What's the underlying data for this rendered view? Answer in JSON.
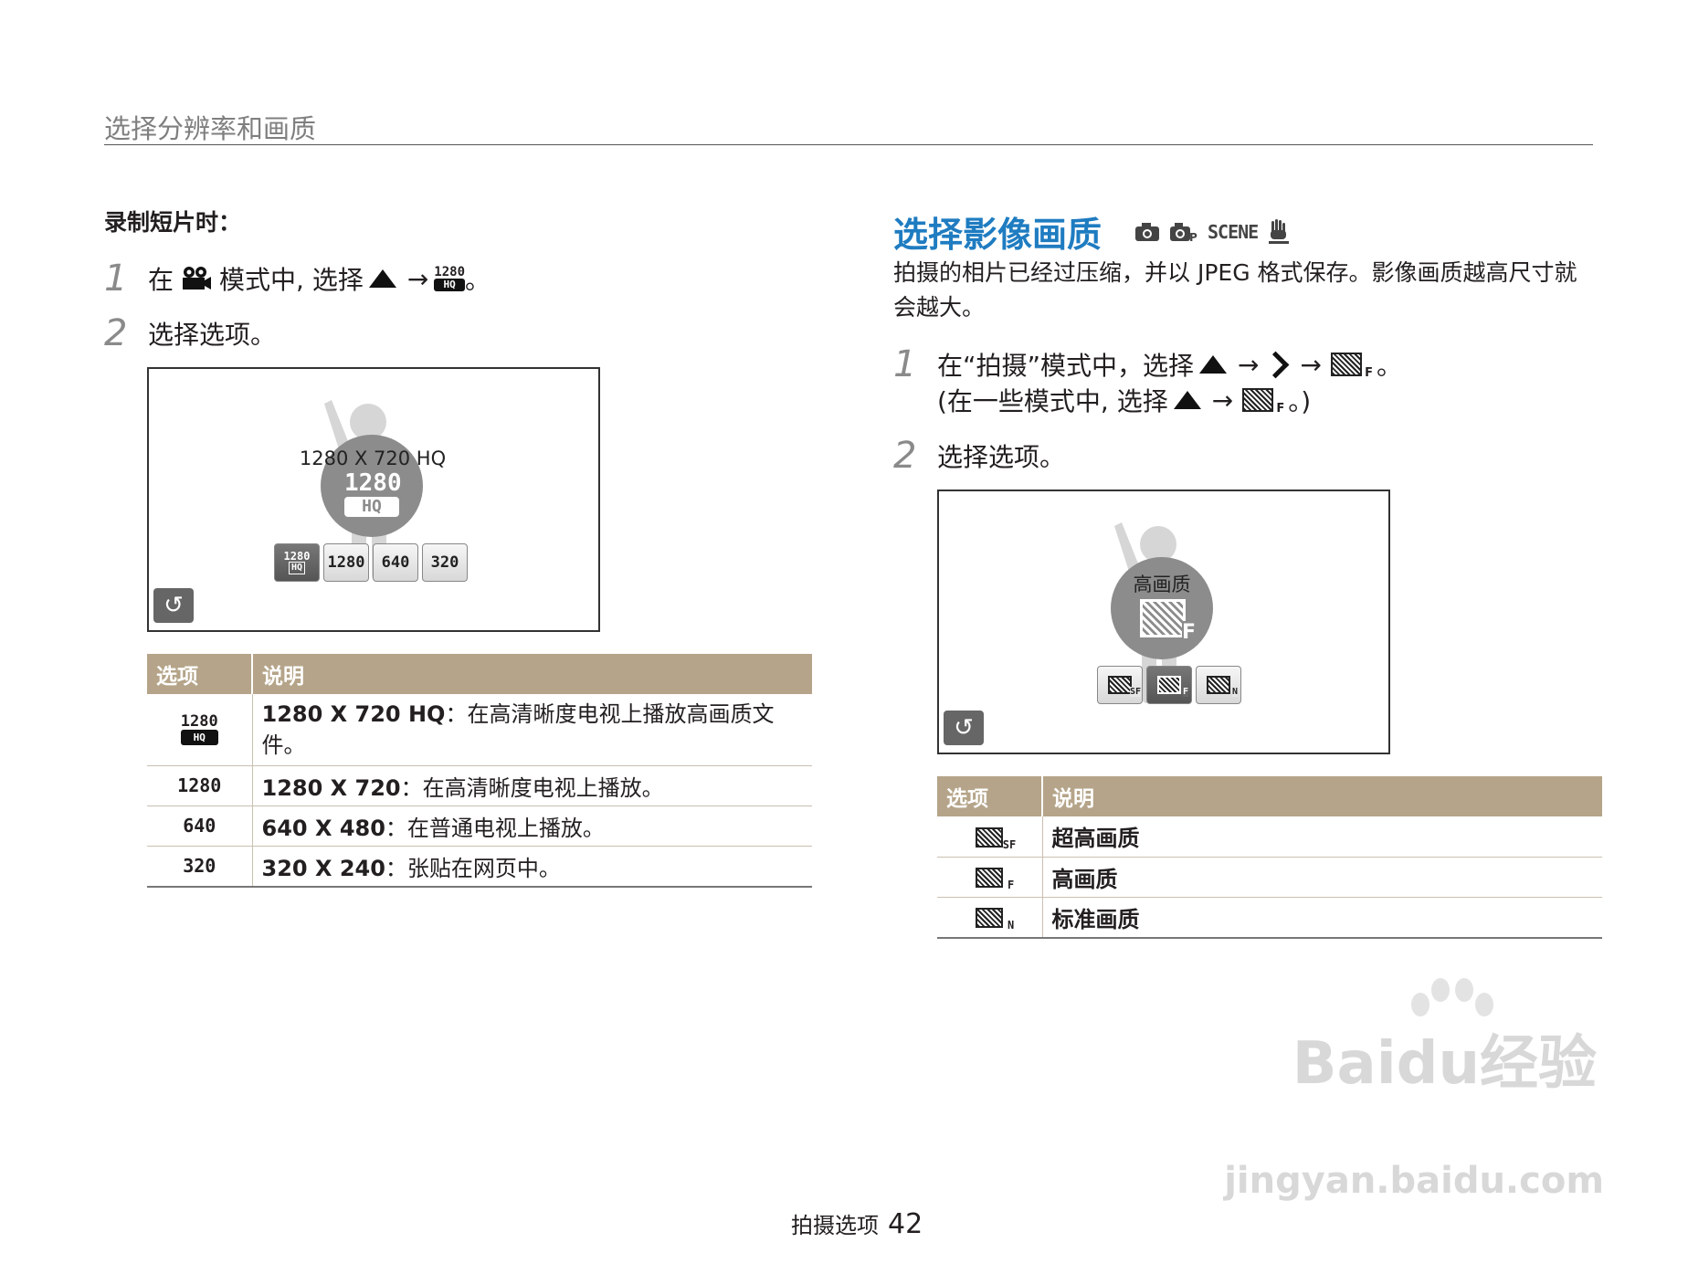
{
  "header": {
    "title": "选择分辨率和画质"
  },
  "left": {
    "subheading": "录制短片时：",
    "step1": {
      "num": "1",
      "pre": "在",
      "mid": "模式中, 选择",
      "arrow": "→",
      "end": "。"
    },
    "step2": {
      "num": "2",
      "text": "选择选项。"
    },
    "screen": {
      "label": "1280 X 720 HQ",
      "big_top": "1280",
      "big_bottom": "HQ",
      "options": [
        "1280 HQ",
        "1280",
        "640",
        "320"
      ],
      "selected_index": 0,
      "back": "↺"
    },
    "table": {
      "headers": [
        "选项",
        "说明"
      ],
      "rows": [
        {
          "icon_top": "1280",
          "icon_bottom": "HQ",
          "bold": "1280 X 720 HQ",
          "desc": "：在高清晰度电视上播放高画质文件。"
        },
        {
          "icon_top": "1280",
          "icon_bottom": "",
          "bold": "1280 X 720",
          "desc": "：在高清晰度电视上播放。"
        },
        {
          "icon_top": "640",
          "icon_bottom": "",
          "bold": "640 X 480",
          "desc": "：在普通电视上播放。"
        },
        {
          "icon_top": "320",
          "icon_bottom": "",
          "bold": "320 X 240",
          "desc": "：张贴在网页中。"
        }
      ]
    }
  },
  "right": {
    "title": "选择影像画质",
    "mode_icons": [
      "camera-icon",
      "smart-camera-icon",
      "SCENE",
      "dual-is-icon"
    ],
    "scene_text": "SCENE",
    "intro": "拍摄的相片已经过压缩，并以 JPEG 格式保存。影像画质越高尺寸就会越大。",
    "step1": {
      "num": "1",
      "pre": "在“拍摄”模式中，选择",
      "arrow": "→",
      "end": "。",
      "line2_pre": "(在一些模式中, 选择",
      "line2_end": "。)"
    },
    "step2": {
      "num": "2",
      "text": "选择选项。"
    },
    "screen": {
      "label": "高画质",
      "options": [
        "SF",
        "F",
        "N"
      ],
      "selected_index": 1,
      "back": "↺"
    },
    "table": {
      "headers": [
        "选项",
        "说明"
      ],
      "rows": [
        {
          "icon": "SF",
          "desc": "超高画质"
        },
        {
          "icon": "F",
          "desc": "高画质"
        },
        {
          "icon": "N",
          "desc": "标准画质"
        }
      ]
    }
  },
  "footer": {
    "section": "拍摄选项",
    "page": "42"
  },
  "watermark": {
    "line1": "Baidu经验",
    "line2": "jingyan.baidu.com"
  }
}
